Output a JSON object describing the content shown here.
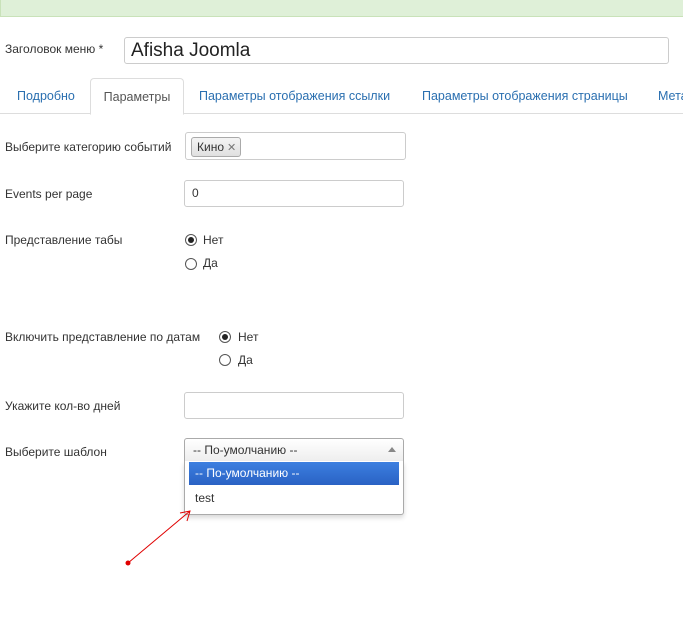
{
  "menu_title": {
    "label": "Заголовок меню *",
    "value": "Afisha Joomla"
  },
  "tabs": [
    {
      "label": "Подробно",
      "active": false
    },
    {
      "label": "Параметры",
      "active": true
    },
    {
      "label": "Параметры отображения ссылки",
      "active": false
    },
    {
      "label": "Параметры отображения страницы",
      "active": false
    },
    {
      "label": "Мета",
      "active": false
    }
  ],
  "params": {
    "category": {
      "label": "Выберите категорию событий",
      "selected": [
        "Кино"
      ],
      "remove_glyph": "✕"
    },
    "events_per_page": {
      "label": "Events per page",
      "value": "0"
    },
    "tabs_view": {
      "label": "Представление табы",
      "options": [
        "Нет",
        "Да"
      ],
      "selected": "Нет"
    },
    "date_view": {
      "label": "Включить представление по датам",
      "options": [
        "Нет",
        "Да"
      ],
      "selected": "Нет"
    },
    "days_count": {
      "label": "Укажите кол-во дней",
      "value": ""
    },
    "template": {
      "label": "Выберите шаблон",
      "selected": "-- По-умолчанию --",
      "options": [
        "-- По-умолчанию --",
        "test"
      ],
      "highlighted": "-- По-умолчанию --"
    }
  },
  "colors": {
    "link": "#2a6fb0",
    "alert_bg": "#dff0d8",
    "highlight": "#3875d7",
    "annotation": "#e00000"
  }
}
